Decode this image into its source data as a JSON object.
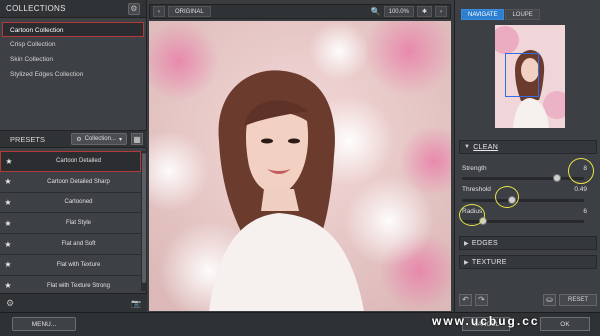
{
  "collections": {
    "title": "COLLECTIONS",
    "items": [
      "Cartoon Collection",
      "Crisp Collection",
      "Skin Collection",
      "Stylized Edges Collection"
    ],
    "selected_index": 0
  },
  "presets": {
    "title": "PRESETS",
    "dropdown": "Collection...",
    "items": [
      "Cartoon Detailed",
      "Cartoon Detailed Sharp",
      "Cartooned",
      "Flat Style",
      "Flat and Soft",
      "Flat with Texture",
      "Flat with Texture Strong"
    ],
    "selected_index": 0
  },
  "topbar": {
    "original_label": "ORIGINAL",
    "zoom": "100.0%"
  },
  "navigator": {
    "tabs": [
      "NAVIGATE",
      "LOUPE"
    ],
    "active_tab": 0
  },
  "clean": {
    "section": "CLEAN",
    "sliders": [
      {
        "label": "Strength",
        "value": "8",
        "fraction": 0.8
      },
      {
        "label": "Threshold",
        "value": "0.49",
        "fraction": 0.4
      },
      {
        "label": "Radius",
        "value": "6",
        "fraction": 0.15
      }
    ]
  },
  "sections": [
    "EDGES",
    "TEXTURE"
  ],
  "buttons": {
    "menu": "MENU...",
    "reset": "RESET",
    "cancel": "CANCEL",
    "ok": "OK"
  },
  "watermark": "www.ucbug.cc",
  "colors": {
    "accent": "#2d7fd0",
    "selection_border": "#b43a3a",
    "highlight": "#e8e24a"
  }
}
